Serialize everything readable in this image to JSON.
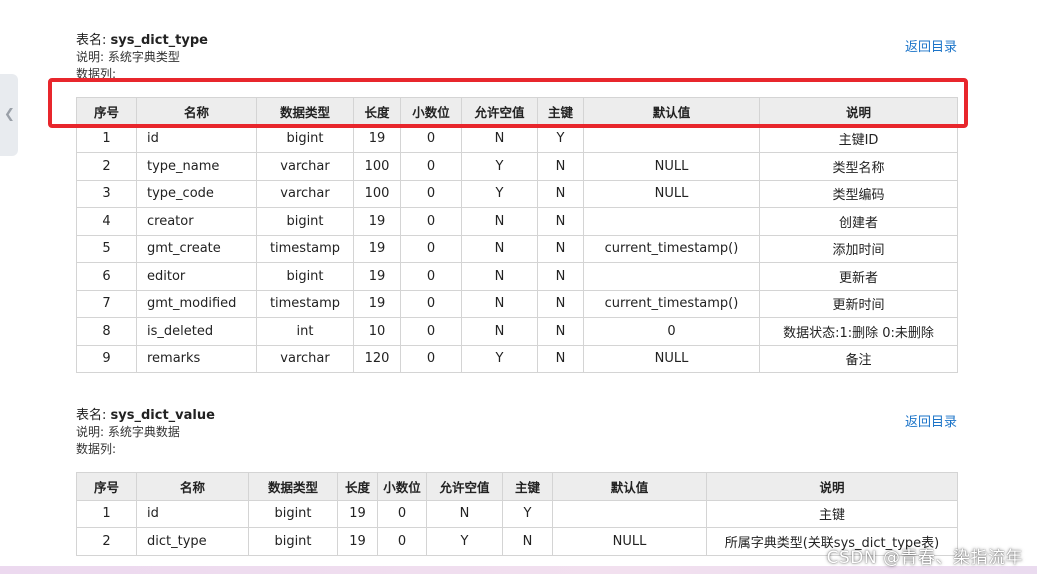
{
  "sections": [
    {
      "title_prefix": "表名:",
      "table_name": "sys_dict_type",
      "desc": "说明: 系统字典类型",
      "cols_label": "数据列:",
      "back_link": "返回目录",
      "headers": [
        "序号",
        "名称",
        "数据类型",
        "长度",
        "小数位",
        "允许空值",
        "主键",
        "默认值",
        "说明"
      ],
      "rows": [
        [
          "1",
          "id",
          "bigint",
          "19",
          "0",
          "N",
          "Y",
          "",
          "主键ID"
        ],
        [
          "2",
          "type_name",
          "varchar",
          "100",
          "0",
          "Y",
          "N",
          "NULL",
          "类型名称"
        ],
        [
          "3",
          "type_code",
          "varchar",
          "100",
          "0",
          "Y",
          "N",
          "NULL",
          "类型编码"
        ],
        [
          "4",
          "creator",
          "bigint",
          "19",
          "0",
          "N",
          "N",
          "",
          "创建者"
        ],
        [
          "5",
          "gmt_create",
          "timestamp",
          "19",
          "0",
          "N",
          "N",
          "current_timestamp()",
          "添加时间"
        ],
        [
          "6",
          "editor",
          "bigint",
          "19",
          "0",
          "N",
          "N",
          "",
          "更新者"
        ],
        [
          "7",
          "gmt_modified",
          "timestamp",
          "19",
          "0",
          "N",
          "N",
          "current_timestamp()",
          "更新时间"
        ],
        [
          "8",
          "is_deleted",
          "int",
          "10",
          "0",
          "N",
          "N",
          "0",
          "数据状态:1:删除 0:未删除"
        ],
        [
          "9",
          "remarks",
          "varchar",
          "120",
          "0",
          "Y",
          "N",
          "NULL",
          "备注"
        ]
      ]
    },
    {
      "title_prefix": "表名:",
      "table_name": "sys_dict_value",
      "desc": "说明: 系统字典数据",
      "cols_label": "数据列:",
      "back_link": "返回目录",
      "headers": [
        "序号",
        "名称",
        "数据类型",
        "长度",
        "小数位",
        "允许空值",
        "主键",
        "默认值",
        "说明"
      ],
      "rows": [
        [
          "1",
          "id",
          "bigint",
          "19",
          "0",
          "N",
          "Y",
          "",
          "主键"
        ],
        [
          "2",
          "dict_type",
          "bigint",
          "19",
          "0",
          "Y",
          "N",
          "NULL",
          "所属字典类型(关联sys_dict_type表)"
        ]
      ]
    }
  ],
  "watermark": "CSDN @青春、染指流年",
  "colors": {
    "highlight": "#e8262c",
    "link": "#1a73c8",
    "header_bg": "#ededed"
  }
}
